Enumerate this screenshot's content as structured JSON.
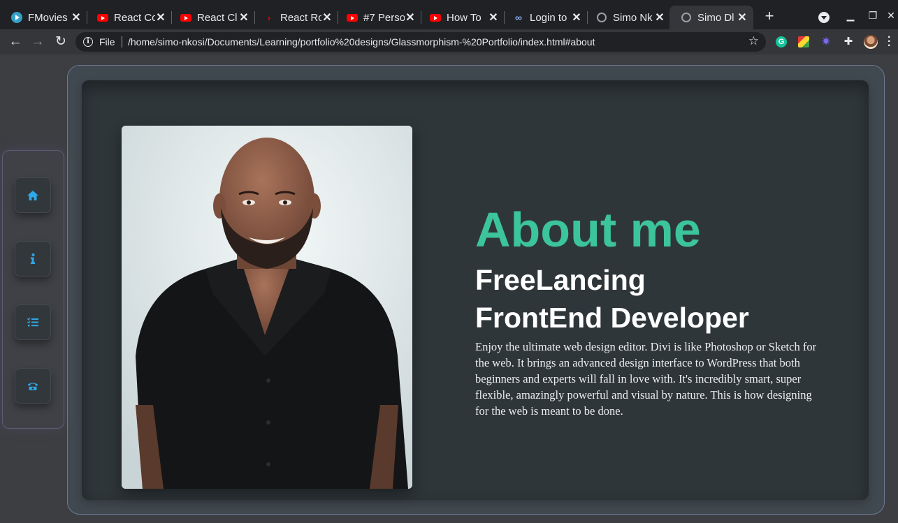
{
  "browser": {
    "tabs": [
      {
        "title": "FMovies",
        "icon": "fmovies-icon"
      },
      {
        "title": "React Co",
        "icon": "youtube-icon"
      },
      {
        "title": "React Cl",
        "icon": "youtube-icon"
      },
      {
        "title": "React Ro",
        "icon": "react-router-icon"
      },
      {
        "title": "#7 Perso",
        "icon": "youtube-icon"
      },
      {
        "title": "How To",
        "icon": "youtube-icon"
      },
      {
        "title": "Login to",
        "icon": "login-icon"
      },
      {
        "title": "Simo Nk",
        "icon": "globe-icon"
      },
      {
        "title": "Simo Dl",
        "icon": "globe-icon",
        "active": true
      }
    ],
    "close_glyph": "✕",
    "new_tab_glyph": "+",
    "address": {
      "scheme_label": "File",
      "url": "/home/simo-nkosi/Documents/Learning/portfolio%20designs/Glassmorphism-%20Portfolio/index.html#about"
    }
  },
  "sidebar": {
    "items": [
      {
        "name": "home",
        "icon": "home-icon",
        "glyph": "⌂"
      },
      {
        "name": "about",
        "icon": "info-icon",
        "glyph": "i"
      },
      {
        "name": "services",
        "icon": "list-check-icon",
        "glyph": "☰"
      },
      {
        "name": "contact",
        "icon": "phone-icon",
        "glyph": "☎"
      }
    ]
  },
  "about": {
    "heading": "About me",
    "subheading": "FreeLancing FrontEnd Developer",
    "paragraph": "Enjoy the ultimate web design editor. Divi is like Photoshop or Sketch for the web. It brings an advanced design interface to WordPress that both beginners and experts will fall in love with. It's incredibly smart, super flexible, amazingly powerful and visual by nature. This is how designing for the web is meant to be done."
  },
  "colors": {
    "accent": "#3cc49a",
    "icon_blue": "#2ea8e8",
    "panel": "#2e363a",
    "page_bg": "#3c3e42"
  }
}
